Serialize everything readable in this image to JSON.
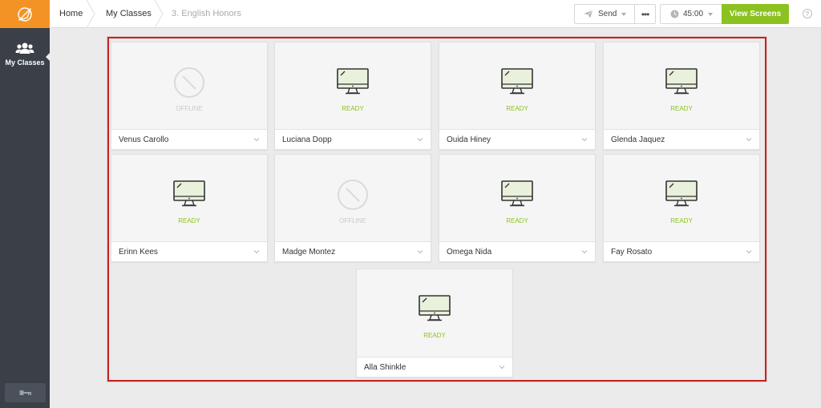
{
  "sidebar": {
    "logo_icon": "compass-icon",
    "items": [
      {
        "label": "My Classes",
        "icon": "group-icon"
      }
    ],
    "bottom_icon": "key-icon"
  },
  "breadcrumb": {
    "home": "Home",
    "classes": "My Classes",
    "current": "3. English Honors"
  },
  "toolbar": {
    "send_label": "Send",
    "more_label": "•••",
    "timer_value": "45:00",
    "view_label": "View Screens",
    "help_label": "?"
  },
  "colors": {
    "accent": "#8cc21f",
    "logo": "#f39325",
    "sidebar": "#3a3f48",
    "highlight": "#c32424"
  },
  "students": [
    {
      "name": "Venus Carollo",
      "status": "OFFLINE"
    },
    {
      "name": "Luciana Dopp",
      "status": "READY"
    },
    {
      "name": "Ouida Hiney",
      "status": "READY"
    },
    {
      "name": "Glenda Jaquez",
      "status": "READY"
    },
    {
      "name": "Erinn Kees",
      "status": "READY"
    },
    {
      "name": "Madge Montez",
      "status": "OFFLINE"
    },
    {
      "name": "Omega Nida",
      "status": "READY"
    },
    {
      "name": "Fay Rosato",
      "status": "READY"
    },
    {
      "name": "Alla Shinkle",
      "status": "READY"
    }
  ]
}
